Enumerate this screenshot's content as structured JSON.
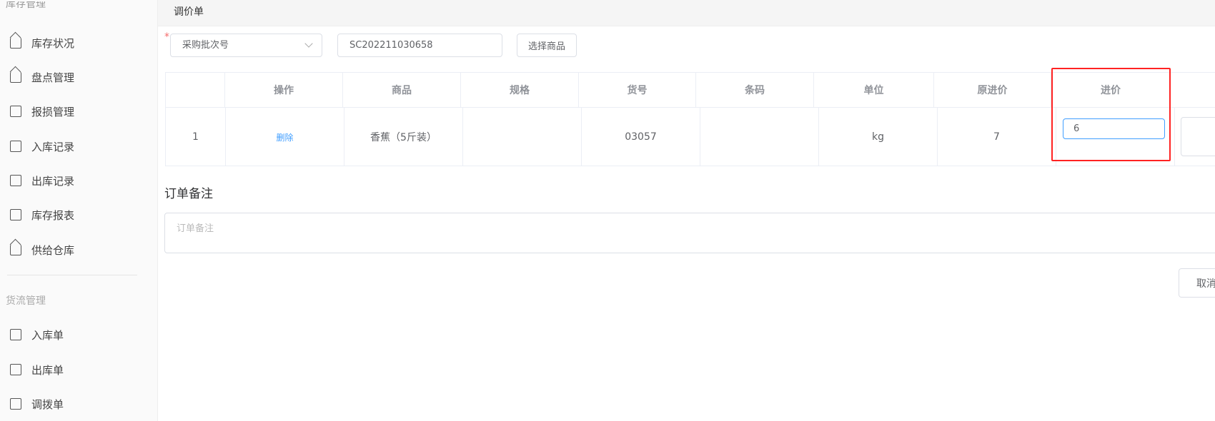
{
  "sidebar": {
    "cut_heading": "库存管理",
    "items": [
      {
        "label": "库存状况",
        "icon": "house-icon"
      },
      {
        "label": "盘点管理",
        "icon": "house-icon"
      },
      {
        "label": "报损管理",
        "icon": "trash-doc-icon"
      },
      {
        "label": "入库记录",
        "icon": "doc-in-icon"
      },
      {
        "label": "出库记录",
        "icon": "doc-out-icon"
      },
      {
        "label": "库存报表",
        "icon": "monitor-icon"
      },
      {
        "label": "供给仓库",
        "icon": "house-icon"
      }
    ],
    "section2": "货流管理",
    "items2": [
      {
        "label": "入库单",
        "icon": "clipboard-in-icon"
      },
      {
        "label": "出库单",
        "icon": "clipboard-out-icon"
      },
      {
        "label": "调拨单",
        "icon": "transfer-icon"
      }
    ]
  },
  "header": {
    "title": "调价单"
  },
  "form": {
    "required_mark": "*",
    "batch_select": "采购批次号",
    "batch_value": "SC202211030658",
    "select_goods": "选择商品"
  },
  "table": {
    "headers": [
      "",
      "操作",
      "商品",
      "规格",
      "货号",
      "条码",
      "单位",
      "原进价",
      "进价",
      ""
    ],
    "rows": [
      {
        "index": "1",
        "action": "删除",
        "product": "香蕉（5斤装）",
        "spec": "",
        "sku": "03057",
        "barcode": "",
        "unit": "kg",
        "old_price": "7",
        "price": "6"
      }
    ]
  },
  "note": {
    "title": "订单备注",
    "placeholder": "订单备注"
  },
  "footer": {
    "cancel": "取消"
  },
  "colors": {
    "accent": "#409eff",
    "highlight": "#ff2222",
    "required": "#f56c6c"
  }
}
